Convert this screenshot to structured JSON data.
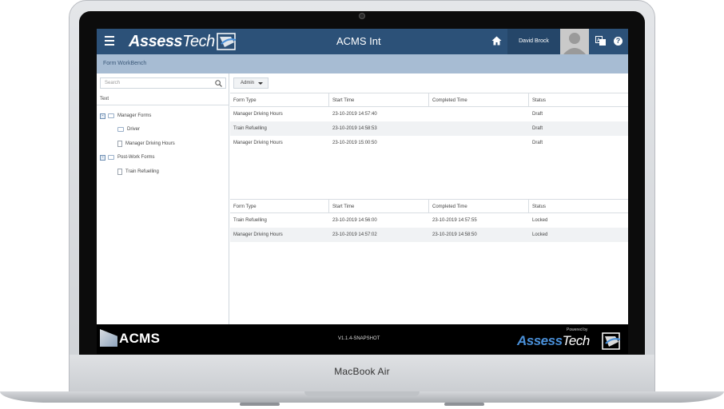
{
  "device": {
    "brand": "MacBook Air"
  },
  "topbar": {
    "logo_bold": "Assess",
    "logo_light": "Tech",
    "app_title": "ACMS Int",
    "user_name": "David Brock",
    "help_glyph": "?"
  },
  "subbar": {
    "title": "Form WorkBench"
  },
  "tree": {
    "search_placeholder": "Search",
    "header": "Text",
    "nodes": [
      {
        "label": "Manager Forms",
        "expander": "-"
      },
      {
        "label": "Driver"
      },
      {
        "label": "Manager Driving Hours"
      },
      {
        "label": "Post-Work Forms",
        "expander": "-"
      },
      {
        "label": "Train Refuelling"
      }
    ]
  },
  "filter": {
    "selected": "Admin"
  },
  "table_top": {
    "columns": [
      "Form Type",
      "Start Time",
      "Completed Time",
      "Status"
    ],
    "rows": [
      [
        "Manager Driving Hours",
        "23-10-2019 14:57:40",
        "",
        "Draft"
      ],
      [
        "Train Refuelling",
        "23-10-2019 14:58:53",
        "",
        "Draft"
      ],
      [
        "Manager Driving Hours",
        "23-10-2019 15:00:50",
        "",
        "Draft"
      ]
    ]
  },
  "table_bottom": {
    "columns": [
      "Form Type",
      "Start Time",
      "Completed Time",
      "Status"
    ],
    "rows": [
      [
        "Train Refuelling",
        "23-10-2019 14:56:00",
        "23-10-2019 14:57:55",
        "Locked"
      ],
      [
        "Manager Driving Hours",
        "23-10-2019 14:57:02",
        "23-10-2019 14:58:50",
        "Locked"
      ]
    ]
  },
  "footer": {
    "acms": "ACMS",
    "version": "V1.1.4-SNAPSHOT",
    "powered_by": "Powered by",
    "logo_bold": "Assess",
    "logo_light": "Tech"
  },
  "colors": {
    "header": "#2c5178",
    "subbar": "#a7bcd3",
    "footer": "#000000"
  },
  "icons": [
    "menu-icon",
    "home-icon",
    "translate-icon",
    "help-icon",
    "search-icon",
    "folder-icon",
    "document-icon"
  ]
}
